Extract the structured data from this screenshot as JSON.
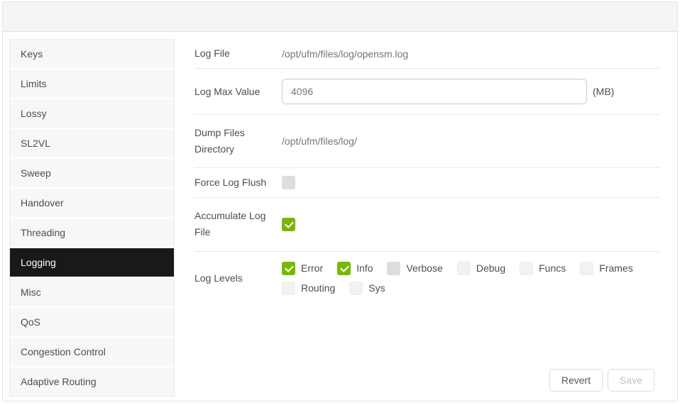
{
  "sidebar": {
    "items": [
      {
        "label": "Keys",
        "state": ""
      },
      {
        "label": "Limits",
        "state": ""
      },
      {
        "label": "Lossy",
        "state": ""
      },
      {
        "label": "SL2VL",
        "state": ""
      },
      {
        "label": "Sweep",
        "state": ""
      },
      {
        "label": "Handover",
        "state": ""
      },
      {
        "label": "Threading",
        "state": ""
      },
      {
        "label": "Logging",
        "state": "selected"
      },
      {
        "label": "Misc",
        "state": ""
      },
      {
        "label": "QoS",
        "state": ""
      },
      {
        "label": "Congestion Control",
        "state": ""
      },
      {
        "label": "Adaptive Routing",
        "state": ""
      }
    ]
  },
  "form": {
    "log_file": {
      "label": "Log File",
      "value": "/opt/ufm/files/log/opensm.log"
    },
    "log_max_value": {
      "label": "Log Max Value",
      "value": "4096",
      "unit": "(MB)"
    },
    "dump_files_directory": {
      "label": "Dump Files Directory",
      "value": "/opt/ufm/files/log/"
    },
    "force_log_flush": {
      "label": "Force Log Flush",
      "checkbox_state": "dim"
    },
    "accumulate_log_file": {
      "label": "Accumulate Log File",
      "checkbox_state": "checked"
    },
    "log_levels": {
      "label": "Log Levels",
      "options": [
        {
          "label": "Error",
          "state": "checked"
        },
        {
          "label": "Info",
          "state": "checked"
        },
        {
          "label": "Verbose",
          "state": "dim"
        },
        {
          "label": "Debug",
          "state": ""
        },
        {
          "label": "Funcs",
          "state": ""
        },
        {
          "label": "Frames",
          "state": ""
        },
        {
          "label": "Routing",
          "state": ""
        },
        {
          "label": "Sys",
          "state": ""
        }
      ]
    }
  },
  "actions": {
    "revert": "Revert",
    "save": "Save"
  },
  "colors": {
    "accent_green": "#76b900",
    "selected_sidebar_bg": "#191919",
    "checkbox_unchecked": "#f2f2f2",
    "checkbox_disabled": "#dddddd",
    "header_band": "#f5f5f5"
  }
}
